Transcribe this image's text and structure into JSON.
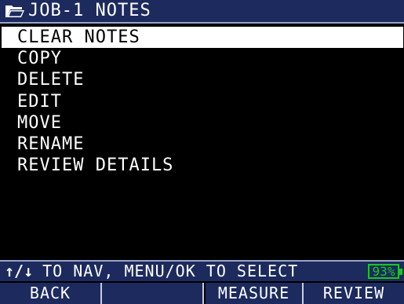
{
  "header": {
    "icon": "folder-icon",
    "title": "JOB-1 NOTES"
  },
  "menu": {
    "items": [
      {
        "label": "CLEAR NOTES",
        "selected": true
      },
      {
        "label": "COPY",
        "selected": false
      },
      {
        "label": "DELETE",
        "selected": false
      },
      {
        "label": "EDIT",
        "selected": false
      },
      {
        "label": "MOVE",
        "selected": false
      },
      {
        "label": "RENAME",
        "selected": false
      },
      {
        "label": "REVIEW DETAILS",
        "selected": false
      }
    ]
  },
  "status": {
    "arrows": "↑/↓",
    "hint": "TO NAV, MENU/OK TO SELECT",
    "battery": "93%"
  },
  "softkeys": [
    "BACK",
    "",
    "",
    "MEASURE",
    "REVIEW"
  ],
  "colors": {
    "bar_bg": "#1c2a5e",
    "battery": "#17c81d",
    "selected_bg": "#ffffff"
  }
}
